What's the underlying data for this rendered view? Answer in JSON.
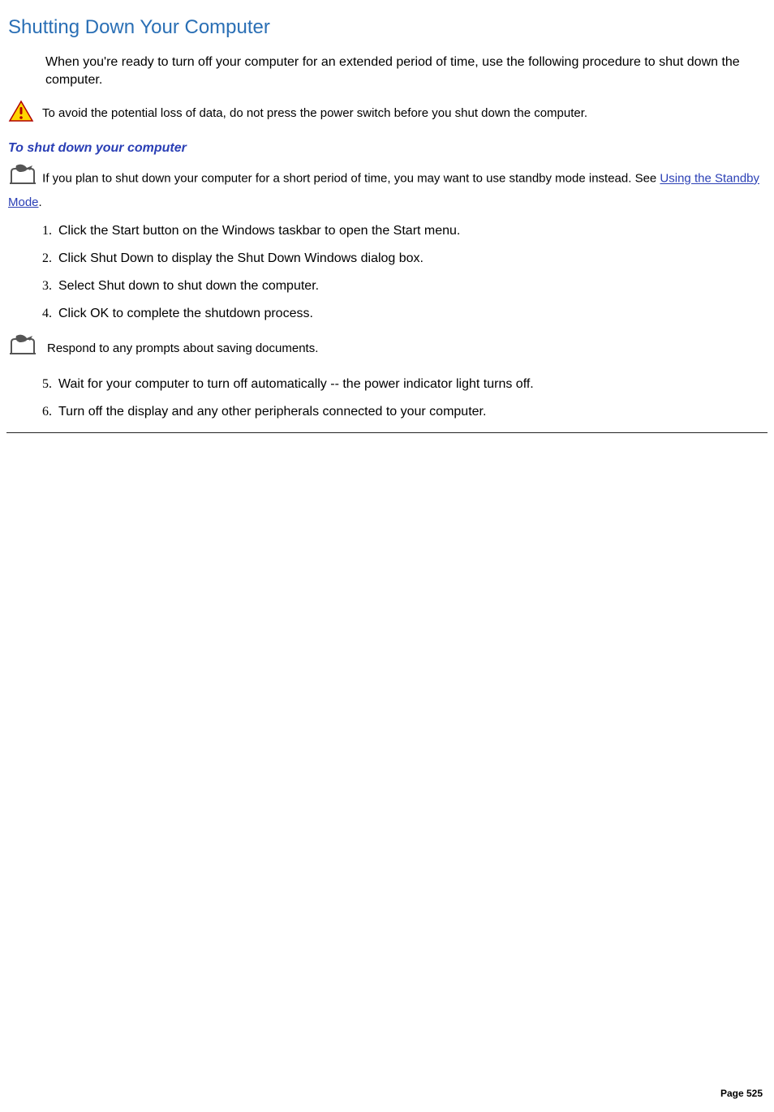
{
  "title": "Shutting Down Your Computer",
  "intro": "When you're ready to turn off your computer for an extended period of time, use the following procedure to shut down the computer.",
  "warning": "To avoid the potential loss of data, do not press the power switch before you shut down the computer.",
  "subhead": "To shut down your computer",
  "note1_pre": "If you plan to shut down your computer for a short period of time, you may want to use standby mode instead. See ",
  "note1_link": "Using the Standby Mode",
  "note1_post": ".",
  "steps": {
    "s1": "Click the Start button on the Windows taskbar to open the Start menu.",
    "s2": "Click Shut Down to display the Shut Down Windows dialog box.",
    "s3": "Select Shut down to shut down the computer.",
    "s4": "Click OK to complete the shutdown process.",
    "s5": "Wait for your computer to turn off automatically -- the power indicator light turns off.",
    "s6": "Turn off the display and any other peripherals connected to your computer."
  },
  "note2": "Respond to any prompts about saving documents.",
  "footer": "Page 525"
}
